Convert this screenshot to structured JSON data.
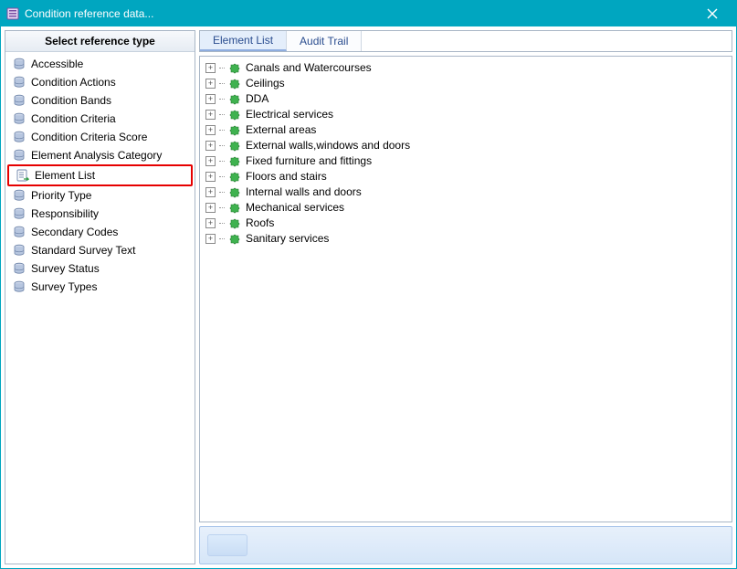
{
  "window": {
    "title": "Condition reference data..."
  },
  "sidebar": {
    "header": "Select reference type",
    "items": [
      {
        "label": "Accessible",
        "icon": "barrel"
      },
      {
        "label": "Condition Actions",
        "icon": "barrel"
      },
      {
        "label": "Condition Bands",
        "icon": "barrel"
      },
      {
        "label": "Condition Criteria",
        "icon": "barrel"
      },
      {
        "label": "Condition Criteria Score",
        "icon": "barrel"
      },
      {
        "label": "Element Analysis Category",
        "icon": "barrel"
      },
      {
        "label": "Element List",
        "icon": "list-arrow",
        "highlighted": true
      },
      {
        "label": "Priority Type",
        "icon": "barrel"
      },
      {
        "label": "Responsibility",
        "icon": "barrel"
      },
      {
        "label": "Secondary Codes",
        "icon": "barrel"
      },
      {
        "label": "Standard Survey Text",
        "icon": "barrel"
      },
      {
        "label": "Survey Status",
        "icon": "barrel"
      },
      {
        "label": "Survey Types",
        "icon": "barrel"
      }
    ]
  },
  "tabs": [
    {
      "label": "Element List",
      "active": true
    },
    {
      "label": "Audit Trail",
      "active": false
    }
  ],
  "tree": {
    "items": [
      {
        "label": "Canals and Watercourses"
      },
      {
        "label": "Ceilings"
      },
      {
        "label": "DDA"
      },
      {
        "label": "Electrical services"
      },
      {
        "label": "External areas"
      },
      {
        "label": "External walls,windows and doors"
      },
      {
        "label": "Fixed furniture and fittings"
      },
      {
        "label": "Floors and stairs"
      },
      {
        "label": "Internal walls and doors"
      },
      {
        "label": "Mechanical services"
      },
      {
        "label": "Roofs"
      },
      {
        "label": "Sanitary services"
      }
    ]
  }
}
